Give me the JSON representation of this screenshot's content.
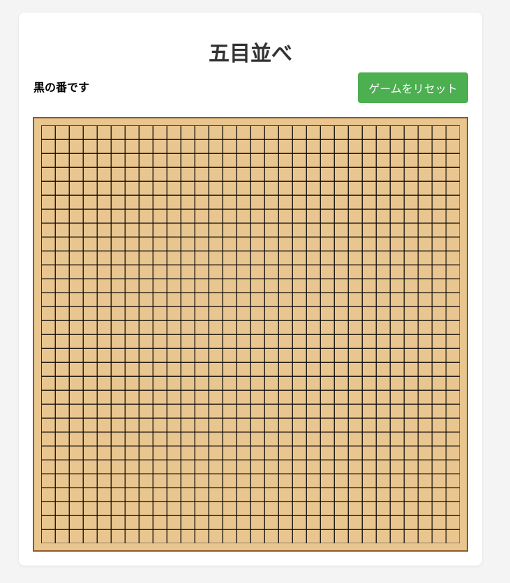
{
  "app": {
    "title": "五目並べ"
  },
  "status": {
    "text": "黒の番です"
  },
  "controls": {
    "reset_label": "ゲームをリセット"
  },
  "board": {
    "cells_per_side": 30,
    "stones": [],
    "colors": {
      "board_background": "#e9c68f",
      "board_border": "#8b5a2b",
      "grid_line": "#000000",
      "reset_button": "#4caf50"
    }
  }
}
